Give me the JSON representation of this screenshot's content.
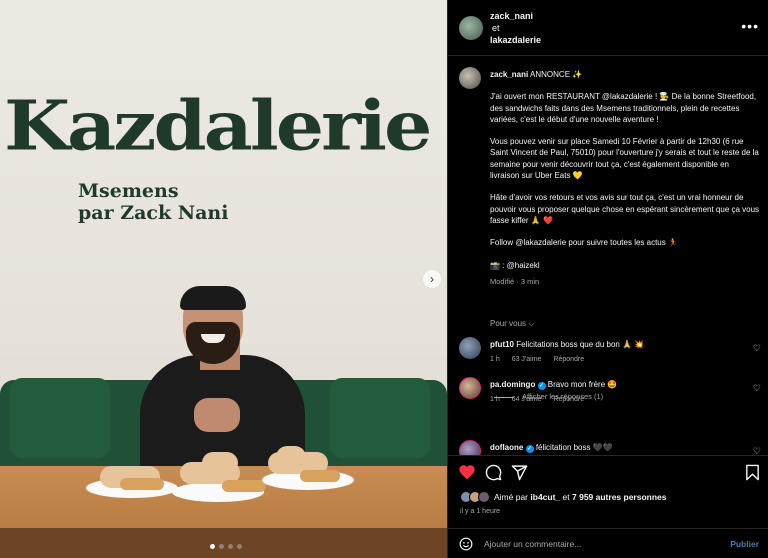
{
  "photo": {
    "brand": "Kazdalerie",
    "tagline_line1": "Msemens",
    "tagline_line2": "par Zack Nani"
  },
  "header": {
    "user1": "zack_nani",
    "conj": "et",
    "user2": "lakazdalerie"
  },
  "caption": {
    "username": "zack_nani",
    "tag": "ANNONCE ✨",
    "p1": "J'ai ouvert mon RESTAURANT @lakazdalerie ! 🧑‍🍳 De la bonne Streetfood, des sandwichs faits dans des Msemens traditionnels, plein de recettes variées, c'est le début d'une nouvelle aventure !",
    "p2": "Vous pouvez venir sur place Samedi 10 Février à partir de 12h30 (6 rue Saint Vincent de Paul, 75010) pour l'ouverture j'y serais et tout le reste de la semaine pour venir découvrir tout ça, c'est également disponible en livraison sur Uber Eats 💛",
    "p3": "Hâte d'avoir vos retours et vos avis sur tout ça, c'est un vrai honneur de pouvoir vous proposer quelque chose en espérant sincèrement que ça vous fasse kiffer 🙏 ❤️",
    "p4": "Follow @lakazdalerie pour suivre toutes les actus 🏃",
    "p5": "📸 : @haizekl",
    "time": "Modifié · 3 min",
    "see_translation": "Pour vous ⌵"
  },
  "comments": [
    {
      "username": "pfut10",
      "verified": false,
      "text": "Felicitations boss que du bon 🙏 💥",
      "time": "1 h",
      "likes": "63 J'aime",
      "reply": "Répondre"
    },
    {
      "username": "pa.domingo",
      "verified": true,
      "text": "Bravo mon frère 🤩",
      "time": "1 h",
      "likes": "64 J'aime",
      "reply": "Répondre"
    },
    {
      "username": "doflaone",
      "verified": true,
      "text": "félicitation boss 🖤🖤",
      "time": "",
      "likes": "",
      "reply": ""
    }
  ],
  "replies_toggle": "Afficher les réponses (1)",
  "likes": {
    "prefix": "Aimé par",
    "user": "ib4cut_",
    "middle": "et",
    "count": "7 959 autres personnes"
  },
  "ago": "il y a 1 heure",
  "add_comment": {
    "placeholder": "Ajouter un commentaire...",
    "publish": "Publier"
  },
  "colors": {
    "heart": "#ff3040",
    "accent": "#0095f6",
    "publish": "#4a7ab5"
  },
  "icons": {
    "like": "heart-icon",
    "comment": "comment-icon",
    "share": "send-icon",
    "save": "bookmark-icon",
    "more": "more-icon",
    "emoji": "emoji-icon",
    "next": "chevron-right-icon"
  }
}
